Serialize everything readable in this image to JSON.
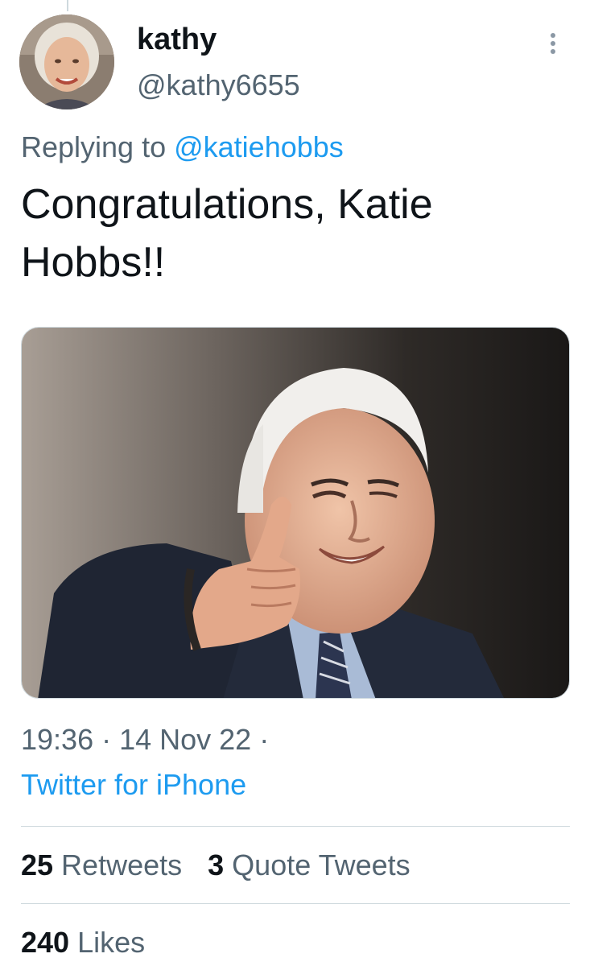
{
  "tweet": {
    "author": {
      "display_name": "kathy",
      "handle": "@kathy6655",
      "avatar": "profile-photo"
    },
    "reply": {
      "prefix": "Replying to ",
      "mention": "@katiehobbs"
    },
    "text": "Congratulations, Katie Hobbs!!",
    "media": {
      "type": "photo",
      "subject": "man-thumbs-up-wink"
    },
    "meta": {
      "time": "19:36",
      "separator1": " · ",
      "date": "14 Nov 22",
      "separator2": " ·",
      "source": "Twitter for iPhone"
    },
    "stats": {
      "retweets": {
        "count": "25",
        "label": " Retweets"
      },
      "quotes": {
        "count": "3",
        "label": " Quote Tweets"
      },
      "likes": {
        "count": "240",
        "label": " Likes"
      }
    }
  },
  "icons": {
    "more": "more-vertical-icon"
  },
  "colors": {
    "link": "#1d9bf0",
    "secondary_text": "#536471",
    "primary_text": "#0f1419",
    "divider": "#cfd9de"
  }
}
